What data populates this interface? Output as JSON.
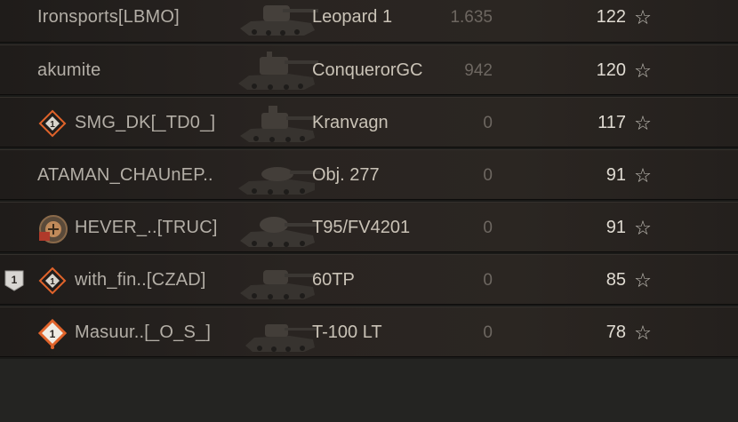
{
  "rows": [
    {
      "player": "Ironsports[LBMO]",
      "vehicle": "Leopard 1",
      "damage": "1.635",
      "score": "122",
      "star": "☆",
      "class_icon": "none",
      "rank_badge": ""
    },
    {
      "player": "akumite",
      "vehicle": "ConquerorGC",
      "damage": "942",
      "score": "120",
      "star": "☆",
      "class_icon": "none",
      "rank_badge": ""
    },
    {
      "player": "SMG_DK[_TD0_]",
      "vehicle": "Kranvagn",
      "damage": "0",
      "score": "117",
      "star": "☆",
      "class_icon": "class-badge-icon",
      "rank_badge": ""
    },
    {
      "player": "ATAMAN_CHAUnEP..",
      "vehicle": "Obj. 277",
      "damage": "0",
      "score": "91",
      "star": "☆",
      "class_icon": "none",
      "rank_badge": ""
    },
    {
      "player": "HEVER_..[TRUC]",
      "vehicle": "T95/FV4201",
      "damage": "0",
      "score": "91",
      "star": "☆",
      "class_icon": "clan-emblem-icon",
      "rank_badge": ""
    },
    {
      "player": "with_fin..[CZAD]",
      "vehicle": "60TP",
      "damage": "0",
      "score": "85",
      "star": "☆",
      "class_icon": "class-badge-icon",
      "rank_badge": "1"
    },
    {
      "player": "Masuur..[_O_S_]",
      "vehicle": "T-100 LT",
      "damage": "0",
      "score": "78",
      "star": "☆",
      "class_icon": "class-badge-orange-icon",
      "rank_badge": ""
    }
  ],
  "colors": {
    "row_bg": "#292421",
    "player_text": "#b3aea6",
    "vehicle_text": "#c9c2b6",
    "damage_text": "#6d6761",
    "score_text": "#e0dbd2",
    "badge_accent": "#e0632a"
  }
}
